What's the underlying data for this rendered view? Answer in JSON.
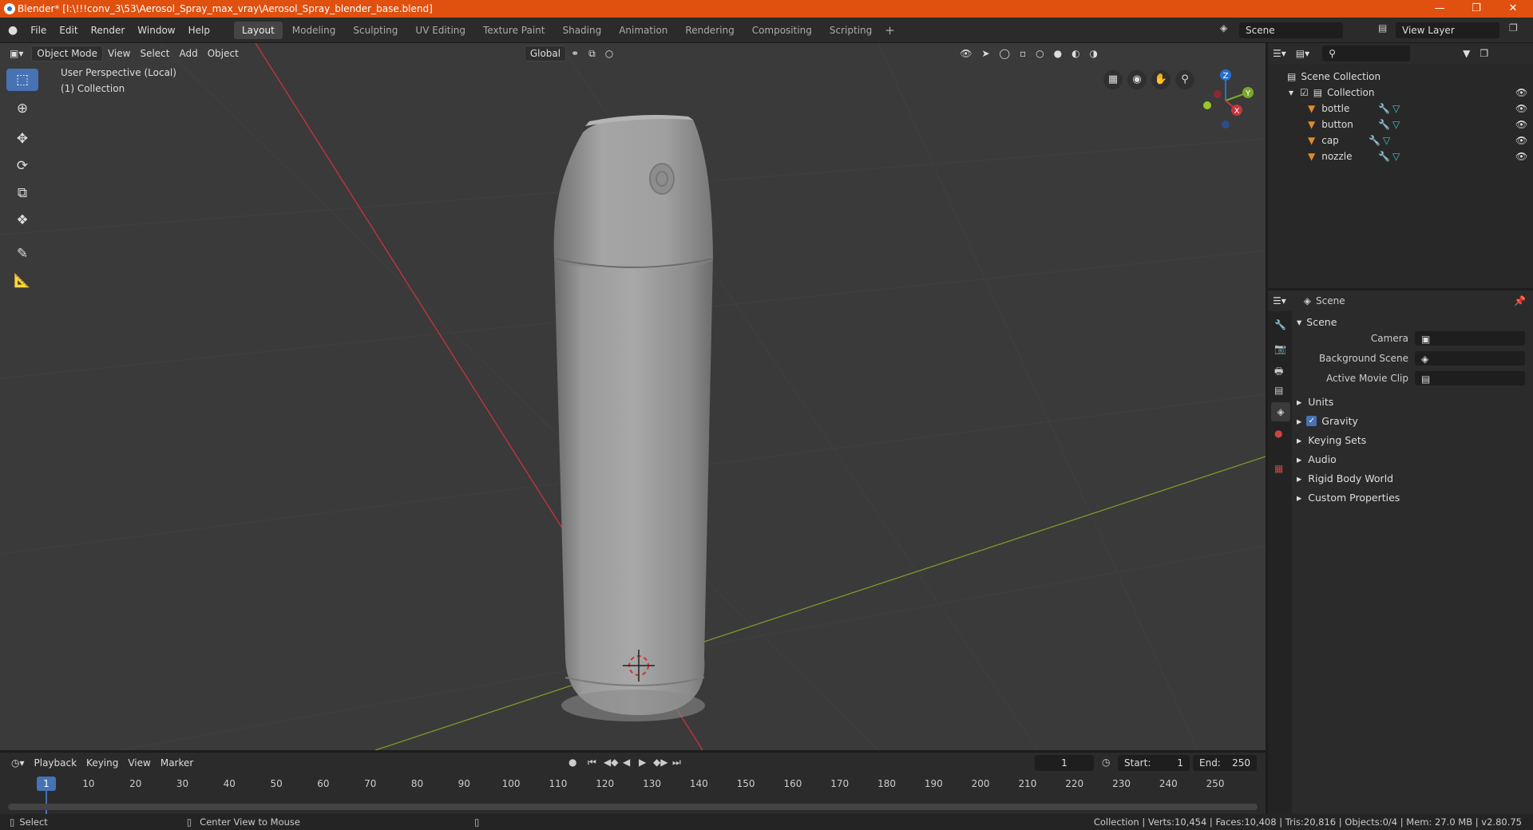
{
  "title": "Blender* [I:\\!!!conv_3\\53\\Aerosol_Spray_max_vray\\Aerosol_Spray_blender_base.blend]",
  "menus": [
    "File",
    "Edit",
    "Render",
    "Window",
    "Help"
  ],
  "workspaces": [
    "Layout",
    "Modeling",
    "Sculpting",
    "UV Editing",
    "Texture Paint",
    "Shading",
    "Animation",
    "Rendering",
    "Compositing",
    "Scripting"
  ],
  "active_workspace": "Layout",
  "scene_name": "Scene",
  "view_layer": "View Layer",
  "viewport": {
    "mode": "Object Mode",
    "menus": [
      "View",
      "Select",
      "Add",
      "Object"
    ],
    "transform": "Global",
    "overlay_line1": "User Perspective (Local)",
    "overlay_line2": "(1) Collection",
    "gizmo": {
      "x": "X",
      "y": "Y",
      "z": "Z"
    }
  },
  "outliner": {
    "root": "Scene Collection",
    "collection": "Collection",
    "items": [
      "bottle",
      "button",
      "cap",
      "nozzle"
    ]
  },
  "properties": {
    "header": "Scene",
    "section": "Scene",
    "camera_label": "Camera",
    "background_label": "Background Scene",
    "movieclip_label": "Active Movie Clip",
    "subsections": [
      "Units",
      "Gravity",
      "Keying Sets",
      "Audio",
      "Rigid Body World",
      "Custom Properties"
    ]
  },
  "timeline": {
    "menus": [
      "Playback",
      "Keying",
      "View",
      "Marker"
    ],
    "current_frame": "1",
    "start_label": "Start:",
    "start": "1",
    "end_label": "End:",
    "end": "250",
    "ticks": [
      "1",
      "10",
      "20",
      "30",
      "40",
      "50",
      "60",
      "70",
      "80",
      "90",
      "100",
      "110",
      "120",
      "130",
      "140",
      "150",
      "160",
      "170",
      "180",
      "190",
      "200",
      "210",
      "220",
      "230",
      "240",
      "250"
    ]
  },
  "status": {
    "left": "Select",
    "mid": "Center View to Mouse",
    "right": "Collection | Verts:10,454 | Faces:10,408 | Tris:20,816 | Objects:0/4 | Mem: 27.0 MB | v2.80.75"
  },
  "colors": {
    "accent": "#4772b3",
    "titlebar": "#e0500f",
    "xaxis": "#c8343e",
    "yaxis": "#7a9a2a"
  }
}
